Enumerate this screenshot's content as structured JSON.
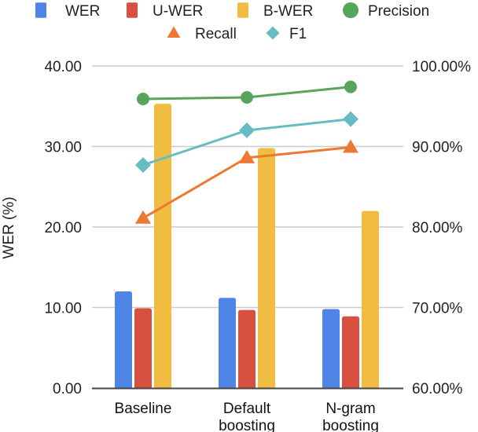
{
  "chart_data": {
    "type": "bar",
    "title": "",
    "xlabel": "",
    "ylabel": "WER (%)",
    "ylabel_right": "",
    "categories": [
      [
        "Baseline"
      ],
      [
        "Default",
        "boosting"
      ],
      [
        "N-gram",
        "boosting"
      ]
    ],
    "category_names": [
      "Baseline",
      "Default boosting",
      "N-gram boosting"
    ],
    "ylim": [
      0,
      40
    ],
    "ylim_right": [
      60,
      100
    ],
    "yticks": [
      "0.00",
      "10.00",
      "20.00",
      "30.00",
      "40.00"
    ],
    "yticks_right": [
      "60.00%",
      "70.00%",
      "80.00%",
      "90.00%",
      "100.00%"
    ],
    "grid": true,
    "legend_position": "top",
    "bar_series": [
      {
        "name": "WER",
        "color": "#5085E8",
        "values": [
          12.0,
          11.2,
          9.8
        ]
      },
      {
        "name": "U-WER",
        "color": "#D95040",
        "values": [
          9.9,
          9.7,
          8.9
        ]
      },
      {
        "name": "B-WER",
        "color": "#F1BC42",
        "values": [
          35.3,
          29.8,
          22.0
        ]
      }
    ],
    "line_series": [
      {
        "name": "Precision",
        "color": "#57A55A",
        "marker": "circle",
        "axis": "right",
        "values": [
          95.9,
          96.1,
          97.4
        ]
      },
      {
        "name": "Recall",
        "color": "#EE7733",
        "marker": "triangle",
        "axis": "right",
        "values": [
          81.1,
          88.6,
          89.9
        ]
      },
      {
        "name": "F1",
        "color": "#67BCC4",
        "marker": "diamond",
        "axis": "right",
        "values": [
          87.7,
          92.0,
          93.4
        ]
      }
    ],
    "legend": [
      {
        "label": "WER",
        "marker": "square",
        "color": "#5085E8"
      },
      {
        "label": "U-WER",
        "marker": "square",
        "color": "#D95040"
      },
      {
        "label": "B-WER",
        "marker": "square",
        "color": "#F1BC42"
      },
      {
        "label": "Precision",
        "marker": "circle",
        "color": "#57A55A"
      },
      {
        "label": "Recall",
        "marker": "triangle",
        "color": "#EE7733"
      },
      {
        "label": "F1",
        "marker": "diamond",
        "color": "#67BCC4"
      }
    ]
  }
}
